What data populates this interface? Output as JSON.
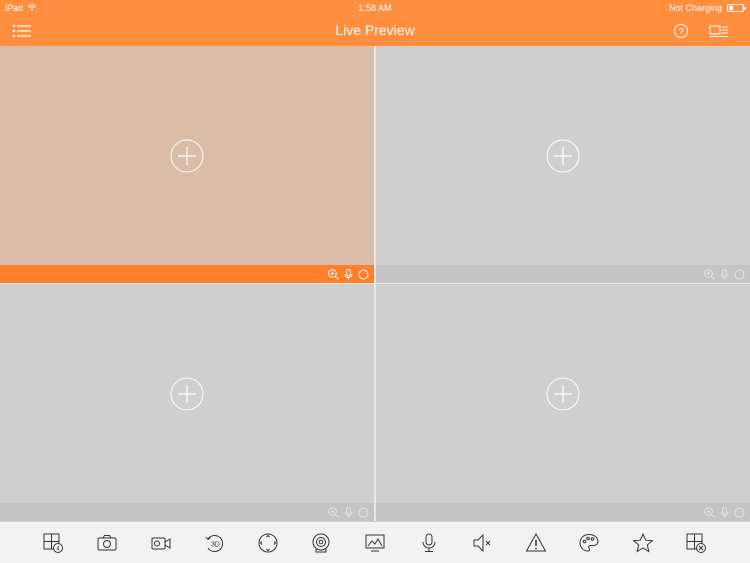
{
  "status_bar": {
    "device": "iPad",
    "time": "1:58 AM",
    "charging": "Not Charging"
  },
  "nav": {
    "title": "Live Preview",
    "left_icon": "list-menu-icon",
    "right_icons": [
      "help-icon",
      "device-list-icon"
    ]
  },
  "colors": {
    "accent": "#ff8f3f",
    "selected_bar": "#ff7f2a",
    "selected_pane": "#dabda8",
    "pane": "#cfcfcf",
    "pane_bar": "#c4c4c4",
    "toolbar_bg": "#f2f2f2"
  },
  "panes": [
    {
      "id": 1,
      "selected": true,
      "icons": [
        "zoom-icon",
        "mic-icon",
        "record-icon"
      ]
    },
    {
      "id": 2,
      "selected": false,
      "icons": [
        "zoom-icon",
        "mic-icon",
        "record-icon"
      ]
    },
    {
      "id": 3,
      "selected": false,
      "icons": [
        "zoom-icon",
        "mic-icon",
        "record-icon"
      ]
    },
    {
      "id": 4,
      "selected": false,
      "icons": [
        "zoom-icon",
        "mic-icon",
        "record-icon"
      ]
    }
  ],
  "toolbar": {
    "icons": [
      "split-screen-icon",
      "snapshot-icon",
      "record-video-icon",
      "3d-positioning-icon",
      "ptz-icon",
      "fisheye-icon",
      "image-quality-icon",
      "talk-icon",
      "audio-off-icon",
      "alarm-icon",
      "color-adjust-icon",
      "favorite-icon",
      "close-all-icon"
    ]
  }
}
